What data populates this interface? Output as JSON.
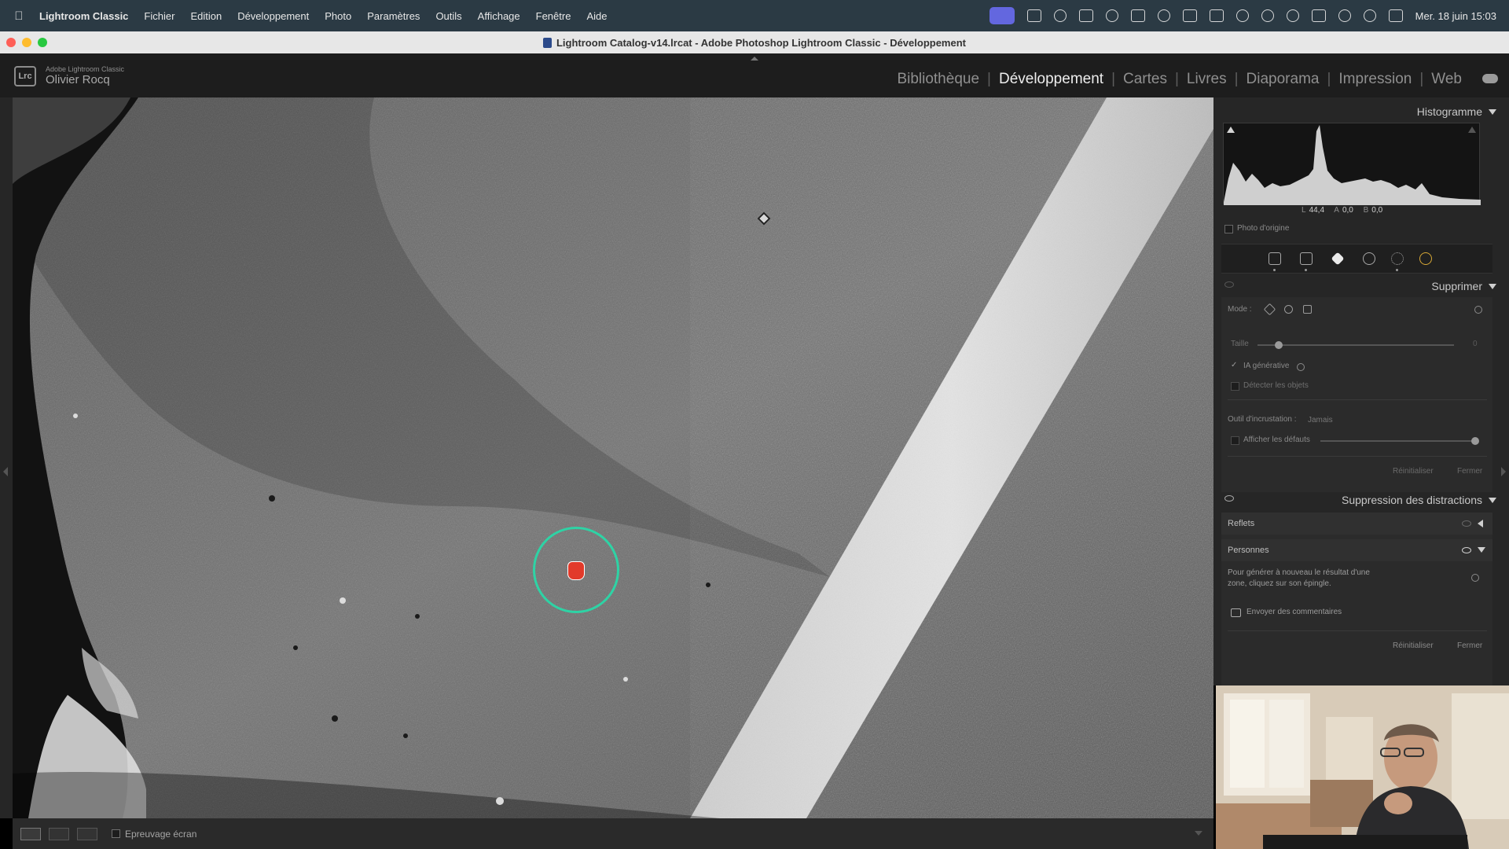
{
  "menubar": {
    "app_name": "Lightroom Classic",
    "items": [
      "Fichier",
      "Edition",
      "Développement",
      "Photo",
      "Paramètres",
      "Outils",
      "Affichage",
      "Fenêtre",
      "Aide"
    ],
    "clock": "Mer. 18 juin  15:03"
  },
  "window": {
    "title": "Lightroom Catalog-v14.lrcat - Adobe Photoshop Lightroom Classic - Développement"
  },
  "identity": {
    "logo_text": "Lrc",
    "product": "Adobe Lightroom Classic",
    "user": "Olivier Rocq"
  },
  "modules": {
    "library": "Bibliothèque",
    "develop": "Développement",
    "maps": "Cartes",
    "books": "Livres",
    "slideshow": "Diaporama",
    "print": "Impression",
    "web": "Web"
  },
  "histogram": {
    "title": "Histogramme",
    "l_label": "L",
    "l_value": "44,4",
    "a_label": "A",
    "a_value": "0,0",
    "b_label": "B",
    "b_value": "0,0",
    "original_photo_label": "Photo d'origine"
  },
  "remove_panel": {
    "title": "Supprimer",
    "mode_label": "Mode :",
    "size_label": "Taille",
    "size_value": "0",
    "generative_ai_label": "IA générative",
    "detect_objects_label": "Détecter les objets",
    "overlay_tool_label": "Outil d'incrustation :",
    "overlay_tool_value": "Jamais",
    "show_defects_label": "Afficher les défauts",
    "reset_label": "Réinitialiser",
    "close_label": "Fermer"
  },
  "distraction_panel": {
    "title": "Suppression des distractions",
    "reflections_label": "Reflets",
    "people_label": "Personnes",
    "help_text_line1": "Pour générer à nouveau le résultat d'une",
    "help_text_line2": "zone, cliquez sur son épingle.",
    "feedback_label": "Envoyer des commentaires",
    "reset_label": "Réinitialiser",
    "close_label": "Fermer"
  },
  "toolbar": {
    "soft_proof_label": "Epreuvage écran"
  },
  "colors": {
    "brush_ring": "#2ed3a5",
    "hand_cursor": "#e23a2a",
    "panel_bg": "#262626",
    "active_module": "#ededed"
  }
}
